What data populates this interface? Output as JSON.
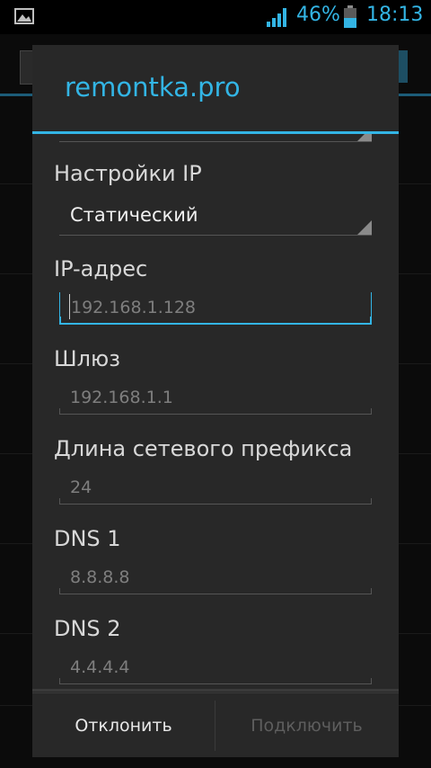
{
  "statusbar": {
    "battery_percent": "46%",
    "time": "18:13",
    "icons": [
      "image-notification-icon",
      "signal-icon",
      "battery-icon"
    ],
    "accent": "#33b5e5"
  },
  "dialog": {
    "title": "remontka.pro",
    "ip_settings": {
      "label": "Настройки IP",
      "value": "Статический"
    },
    "ip_address": {
      "label": "IP-адрес",
      "placeholder": "192.168.1.128"
    },
    "gateway": {
      "label": "Шлюз",
      "placeholder": "192.168.1.1"
    },
    "prefix_length": {
      "label": "Длина сетевого префикса",
      "placeholder": "24"
    },
    "dns1": {
      "label": "DNS 1",
      "placeholder": "8.8.8.8"
    },
    "dns2": {
      "label": "DNS 2",
      "placeholder": "4.4.4.4"
    },
    "buttons": {
      "cancel": "Отклонить",
      "connect": "Подключить"
    }
  },
  "colors": {
    "accent": "#33b5e5",
    "dialog_bg": "#282828",
    "disabled_text": "#5e5e5e"
  }
}
